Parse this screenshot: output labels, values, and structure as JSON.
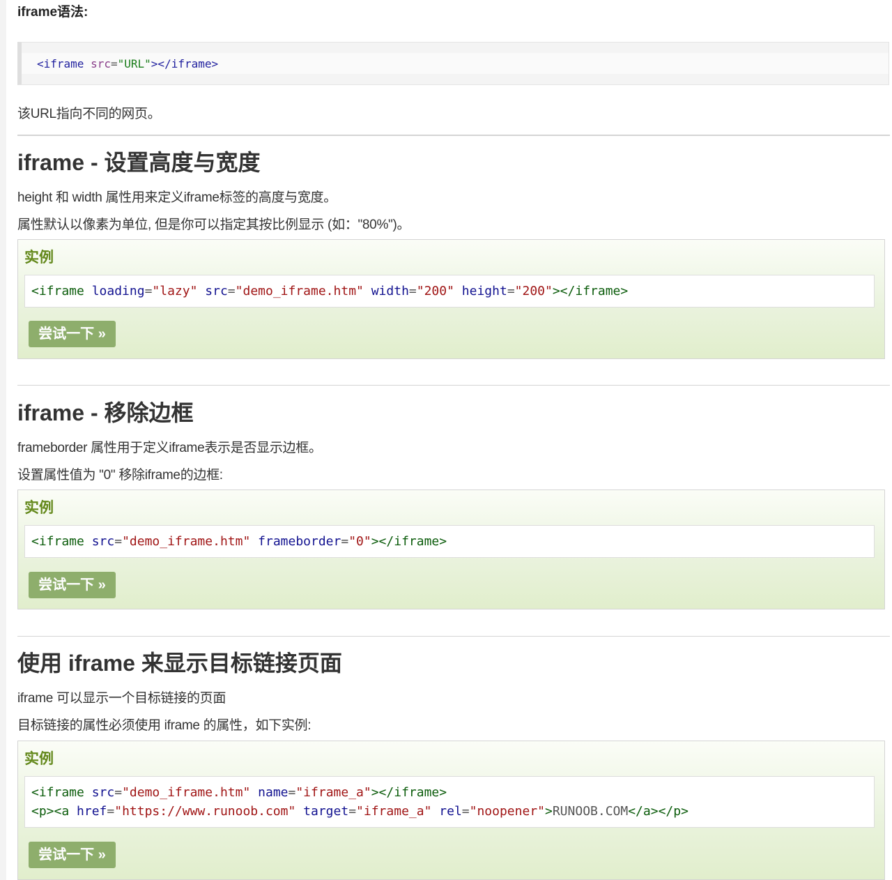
{
  "syntax": {
    "heading": "iframe语法:",
    "code": {
      "open": "<iframe",
      "attr": "src",
      "eq": "=",
      "val": "\"URL\"",
      "close": "></iframe>"
    },
    "note": "该URL指向不同的网页。"
  },
  "sections": [
    {
      "title": "iframe - 设置高度与宽度",
      "paragraphs": [
        "height 和 width 属性用来定义iframe标签的高度与宽度。",
        "属性默认以像素为单位, 但是你可以指定其按比例显示 (如：\"80%\")。"
      ],
      "example_label": "实例",
      "button": "尝试一下 »",
      "code": {
        "t1": "<iframe",
        "a1": "loading",
        "v1": "\"lazy\"",
        "a2": "src",
        "v2": "\"demo_iframe.htm\"",
        "a3": "width",
        "v3": "\"200\"",
        "a4": "height",
        "v4": "\"200\"",
        "t2": "></iframe>"
      }
    },
    {
      "title": "iframe - 移除边框",
      "paragraphs": [
        "frameborder 属性用于定义iframe表示是否显示边框。",
        "设置属性值为 \"0\" 移除iframe的边框:"
      ],
      "example_label": "实例",
      "button": "尝试一下 »",
      "code": {
        "t1": "<iframe",
        "a1": "src",
        "v1": "\"demo_iframe.htm\"",
        "a2": "frameborder",
        "v2": "\"0\"",
        "t2": "></iframe>"
      }
    },
    {
      "title": "使用 iframe 来显示目标链接页面",
      "paragraphs": [
        "iframe 可以显示一个目标链接的页面",
        "目标链接的属性必须使用 iframe 的属性，如下实例:"
      ],
      "example_label": "实例",
      "button": "尝试一下 »",
      "code": {
        "line1": {
          "t1": "<iframe",
          "a1": "src",
          "v1": "\"demo_iframe.htm\"",
          "a2": "name",
          "v2": "\"iframe_a\"",
          "t2": "></iframe>"
        },
        "line2": {
          "t1": "<p><a",
          "a1": "href",
          "v1": "\"https://www.runoob.com\"",
          "a2": "target",
          "v2": "\"iframe_a\"",
          "a3": "rel",
          "v3": "\"noopener\"",
          "t2": ">",
          "text": "RUNOOB.COM",
          "t3": "</a></p>"
        }
      }
    }
  ],
  "colors": {
    "tag": "#0b5c0b",
    "attribute": "#121290",
    "value": "#a01515",
    "example_label": "#64891c",
    "button_bg": "#8eae6c"
  }
}
